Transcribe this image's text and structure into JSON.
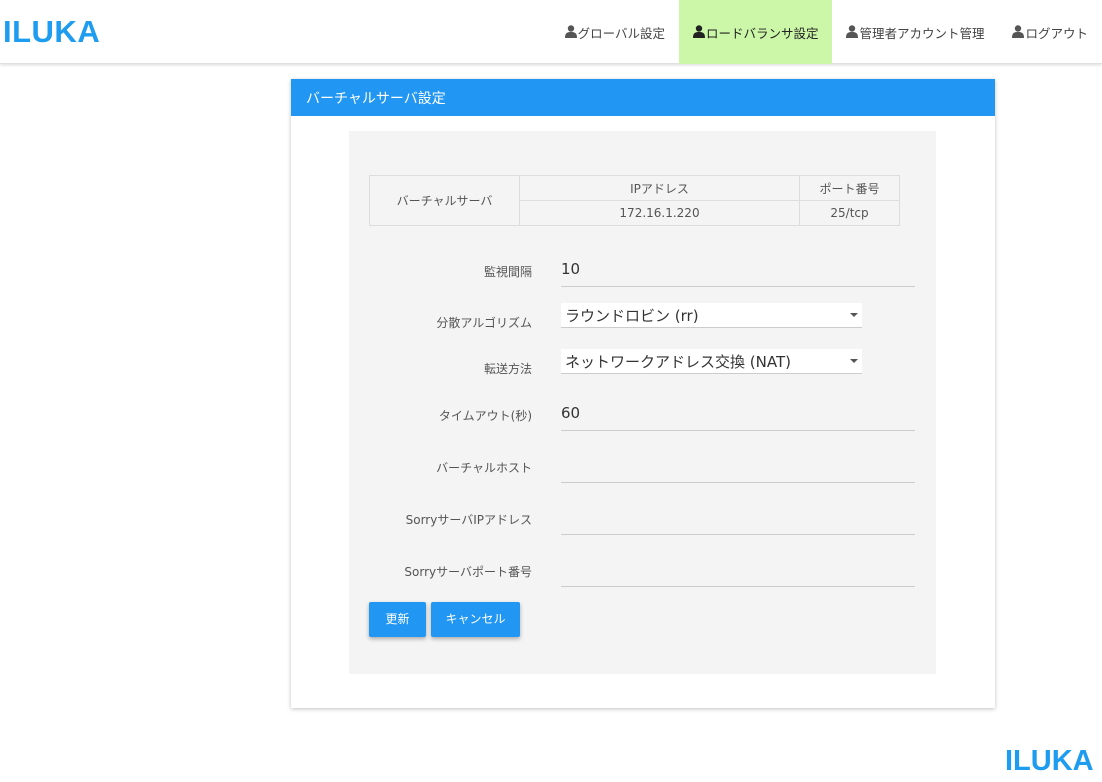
{
  "header": {
    "brand": "ILUKA",
    "nav": [
      {
        "label": "グローバル設定",
        "icon": "user-icon"
      },
      {
        "label": "ロードバランサ設定",
        "icon": "user-icon",
        "active": true
      },
      {
        "label": "管理者アカウント管理",
        "icon": "user-icon"
      },
      {
        "label": "ログアウト",
        "icon": "user-icon"
      }
    ]
  },
  "card": {
    "title": "バーチャルサーバ設定"
  },
  "virtual_server_table": {
    "row_header": "バーチャルサーバ",
    "col_ip": "IPアドレス",
    "col_port": "ポート番号",
    "ip_value": "172.16.1.220",
    "port_value": "25/tcp"
  },
  "form": {
    "interval": {
      "label": "監視間隔",
      "value": "10"
    },
    "algorithm": {
      "label": "分散アルゴリズム",
      "value": "ラウンドロビン (rr)"
    },
    "forwarding": {
      "label": "転送方法",
      "value": "ネットワークアドレス交換 (NAT)"
    },
    "timeout": {
      "label": "タイムアウト(秒)",
      "value": "60"
    },
    "virtual_host": {
      "label": "バーチャルホスト",
      "value": ""
    },
    "sorry_ip": {
      "label": "SorryサーバIPアドレス",
      "value": ""
    },
    "sorry_port": {
      "label": "Sorryサーバポート番号",
      "value": ""
    }
  },
  "buttons": {
    "update": "更新",
    "cancel": "キャンセル"
  },
  "footer": {
    "brand": "ILUKA"
  },
  "colors": {
    "accent": "#2196f3",
    "brand": "#1e9cf0",
    "active_nav": "#ccf7a8"
  }
}
